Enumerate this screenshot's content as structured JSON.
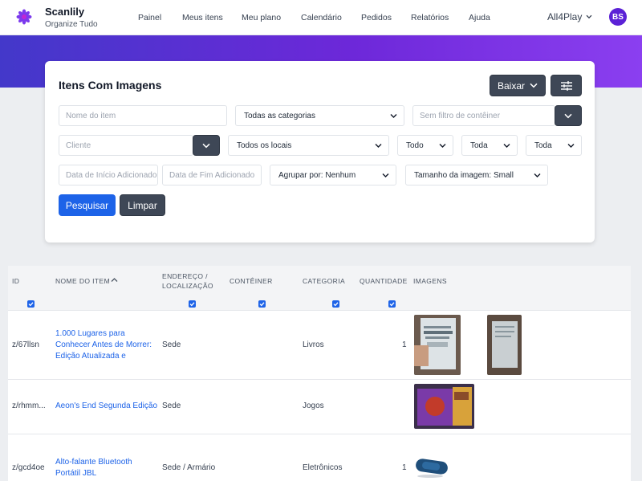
{
  "brand": {
    "name": "Scanlily",
    "tagline": "Organize Tudo",
    "logo_icon": "scanlily-flower-icon"
  },
  "nav": {
    "items": [
      "Painel",
      "Meus itens",
      "Meu plano",
      "Calendário",
      "Pedidos",
      "Relatórios",
      "Ajuda"
    ],
    "account_label": "All4Play",
    "avatar_initials": "BS"
  },
  "colors": {
    "accent": "#1d63e8",
    "brand_purple": "#6d28d9",
    "dark_button": "#3e4756"
  },
  "filters": {
    "title": "Itens Com Imagens",
    "download_label": "Baixar",
    "settings_icon": "sliders-icon",
    "item_name_placeholder": "Nome do item",
    "category_value": "Todas as categorias",
    "container_placeholder": "Sem filtro de contêiner",
    "client_placeholder": "Cliente",
    "location_value": "Todos os locais",
    "select_todo": "Todo",
    "select_toda_1": "Toda",
    "select_toda_2": "Toda",
    "start_date_placeholder": "Data de Início Adicionado",
    "end_date_placeholder": "Data de Fim Adicionado",
    "group_by_value": "Agrupar por: Nenhum",
    "image_size_value": "Tamanho da imagem: Small",
    "search_label": "Pesquisar",
    "clear_label": "Limpar"
  },
  "table": {
    "headers": {
      "id": "ID",
      "name": "NOME DO ITEM",
      "address_1": "ENDEREÇO /",
      "address_2": "LOCALIZAÇÃO",
      "container": "CONTÊINER",
      "category": "CATEGORIA",
      "quantity": "QUANTIDADE",
      "images": "IMAGENS"
    },
    "rows": [
      {
        "id": "z/67llsn",
        "name_lines": [
          "1.000 Lugares para",
          "Conhecer Antes de Morrer:",
          "Edição Atualizada e"
        ],
        "address": "Sede",
        "container": "",
        "category": "Livros",
        "quantity": "1",
        "images": [
          "book-cover-photo",
          "book-back-photo"
        ]
      },
      {
        "id": "z/rhmm...",
        "name_lines": [
          "Aeon's End Segunda Edição"
        ],
        "address": "Sede",
        "container": "",
        "category": "Jogos",
        "quantity": "",
        "images": [
          "board-game-box-photo"
        ]
      },
      {
        "id": "z/gcd4oe",
        "name_lines": [
          "Alto-falante Bluetooth",
          "Portátil JBL"
        ],
        "address": "Sede / Armário",
        "container": "",
        "category": "Eletrônicos",
        "quantity": "1",
        "images": [
          "bluetooth-speaker-photo"
        ]
      }
    ]
  }
}
